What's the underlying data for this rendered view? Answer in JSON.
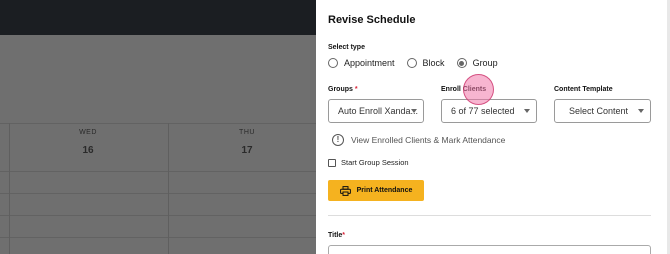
{
  "calendar": {
    "days": [
      {
        "name": "WED",
        "number": "16"
      },
      {
        "name": "THU",
        "number": "17"
      }
    ]
  },
  "modal": {
    "title": "Revise Schedule",
    "select_type": {
      "label": "Select type",
      "options": [
        "Appointment",
        "Block",
        "Group"
      ],
      "selected": "Group"
    },
    "groups": {
      "label": "Groups",
      "required_mark": "*",
      "value": "Auto Enroll Xanda..."
    },
    "enroll_clients": {
      "label": "Enroll Clients",
      "value": "6 of 77 selected"
    },
    "content_template": {
      "label": "Content Template",
      "value": "Select Content"
    },
    "view_enrolled_link": "View Enrolled Clients & Mark Attendance",
    "start_group_session": "Start Group Session",
    "print_attendance": "Print Attendance",
    "title_field": {
      "label": "Title",
      "required_mark": "*"
    }
  },
  "colors": {
    "accent_button": "#f5b21f",
    "required_asterisk": "#d9263a",
    "cursor_highlight": "#f078aa"
  }
}
